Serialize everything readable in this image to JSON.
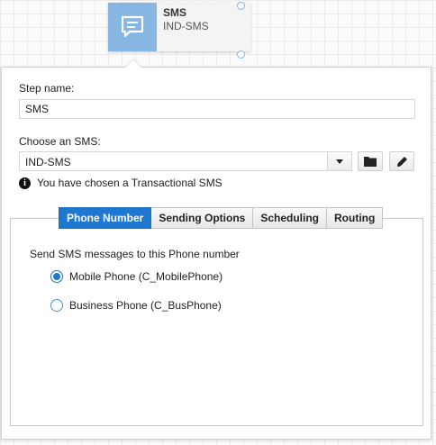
{
  "node": {
    "title": "SMS",
    "subtitle": "IND-SMS",
    "icon": "chat-message-icon",
    "icon_color": "#88b6e3"
  },
  "panel": {
    "step_name_label": "Step name:",
    "step_name_value": "SMS",
    "choose_sms_label": "Choose an SMS:",
    "choose_sms_value": "IND-SMS",
    "info_text": "You have chosen a Transactional SMS",
    "buttons": {
      "browse_icon": "folder-icon",
      "edit_icon": "pencil-icon"
    }
  },
  "tabs": [
    {
      "label": "Phone Number",
      "active": true
    },
    {
      "label": "Sending Options",
      "active": false
    },
    {
      "label": "Scheduling",
      "active": false
    },
    {
      "label": "Routing",
      "active": false
    }
  ],
  "phone_number": {
    "heading": "Send SMS messages to this Phone number",
    "options": [
      {
        "label": "Mobile Phone (C_MobilePhone)",
        "checked": true
      },
      {
        "label": "Business Phone (C_BusPhone)",
        "checked": false
      }
    ]
  },
  "colors": {
    "accent": "#1f78cf",
    "node_icon_bg": "#88b6e3"
  }
}
